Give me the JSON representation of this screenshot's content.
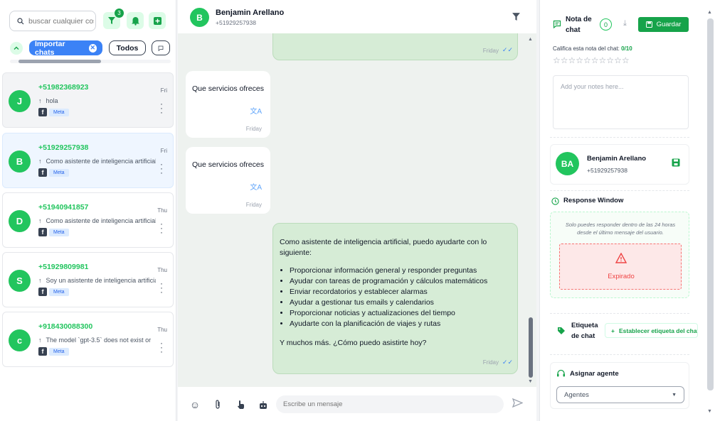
{
  "sidebar": {
    "search_placeholder": "buscar cualquier cosa",
    "filter_badge": "3",
    "chips": {
      "import": "Importar chats",
      "all": "Todos"
    },
    "chats": [
      {
        "initial": "J",
        "phone": "+51982368923",
        "preview": "hola",
        "time": "Fri",
        "source": "Meta"
      },
      {
        "initial": "B",
        "phone": "+51929257938",
        "preview": "Como asistente de inteligencia artificial",
        "time": "Fri",
        "source": "Meta"
      },
      {
        "initial": "D",
        "phone": "+51940941857",
        "preview": "Como asistente de inteligencia artificial",
        "time": "Thu",
        "source": "Meta"
      },
      {
        "initial": "S",
        "phone": "+51929809981",
        "preview": "Soy un asistente de inteligencia artificial",
        "time": "Thu",
        "source": "Meta"
      },
      {
        "initial": "c",
        "phone": "+918430088300",
        "preview": "The model `gpt-3.5` does not exist or",
        "time": "Thu",
        "source": "Meta"
      }
    ]
  },
  "conversation": {
    "header": {
      "initial": "B",
      "name": "Benjamin Arellano",
      "phone": "+51929257938"
    },
    "messages": {
      "m0_time": "Friday",
      "m1_text": "Que servicios ofreces",
      "m1_time": "Friday",
      "m2_text": "Que servicios ofreces",
      "m2_time": "Friday",
      "m3_intro": "Como asistente de inteligencia artificial, puedo ayudarte con lo siguiente:",
      "m3_items": [
        "Proporcionar información general y responder preguntas",
        "Ayudar con tareas de programación y cálculos matemáticos",
        "Enviar recordatorios y establecer alarmas",
        "Ayudar a gestionar tus emails y calendarios",
        "Proporcionar noticias y actualizaciones del tiempo",
        "Ayudarte con la planificación de viajes y rutas"
      ],
      "m3_outro": "Y muchos más. ¿Cómo puedo asistirte hoy?",
      "m3_time": "Friday"
    },
    "composer_placeholder": "Escribe un mensaje"
  },
  "details": {
    "note_title": "Nota de chat",
    "note_count": "0",
    "save_label": "Guardar",
    "rate_label": "Califica esta nota del chat:",
    "rate_value": "0/10",
    "notes_placeholder": "Add your notes here...",
    "contact": {
      "initials": "BA",
      "name": "Benjamin Arellano",
      "phone": "+51929257938"
    },
    "response_window": {
      "title": "Response Window",
      "desc": "Solo puedes responder dentro de las 24 horas desde el último mensaje del usuario.",
      "status": "Expirado"
    },
    "tag": {
      "title": "Etiqueta de chat",
      "button": "Establecer etiqueta del chat"
    },
    "agent": {
      "title": "Asignar agente",
      "select_value": "Agentes"
    }
  },
  "colors": {
    "accent": "#22c55e",
    "brand_blue": "#3b82f6",
    "danger": "#ef4444"
  }
}
